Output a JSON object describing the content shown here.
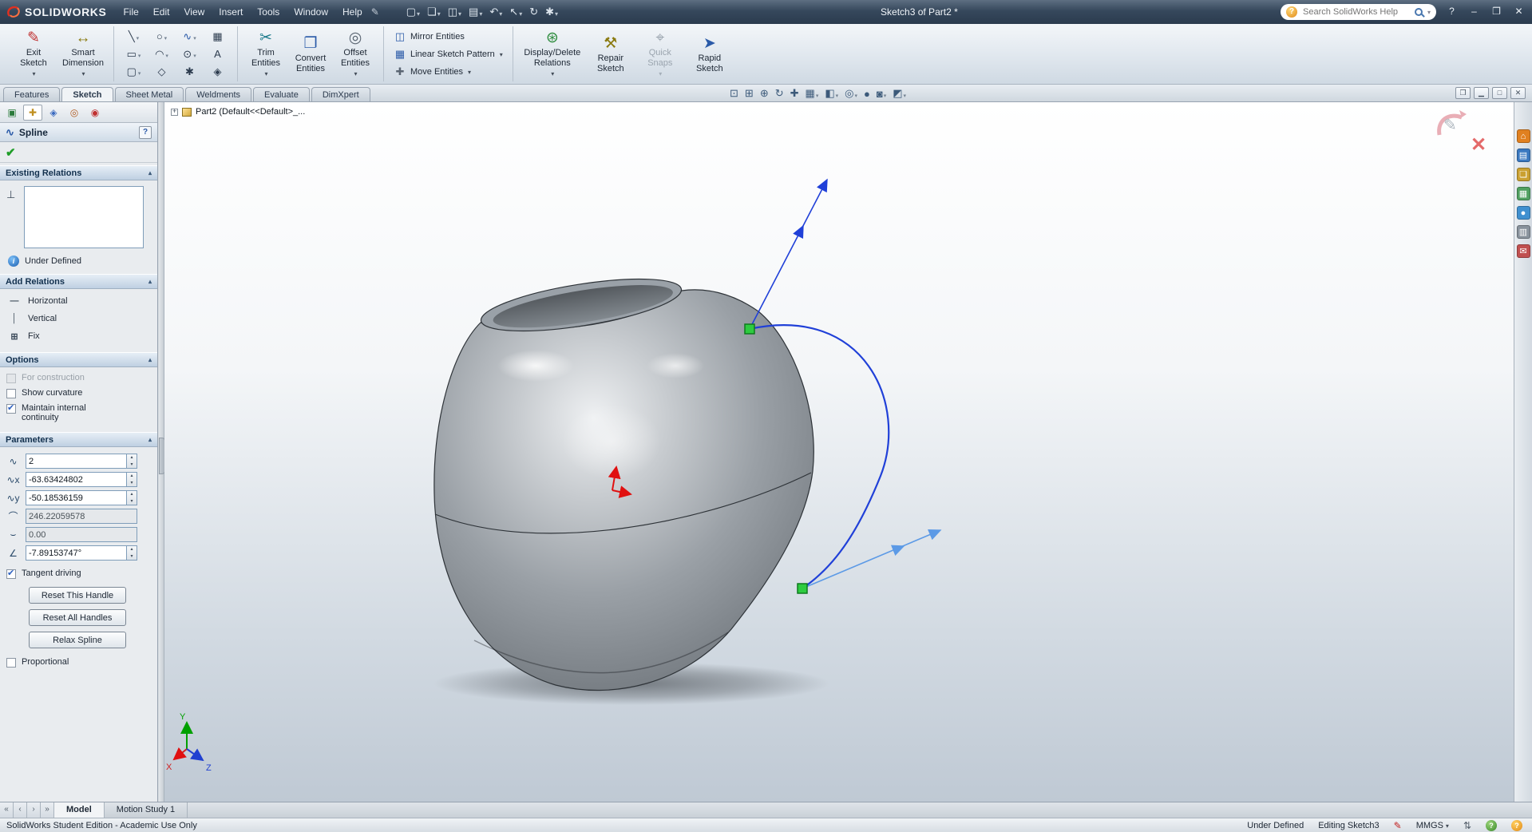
{
  "colors": {
    "spline_blue": "#2040d8",
    "tangent_blue": "#5c9ae6",
    "point_green": "#2ecc40",
    "origin_red": "#e01010",
    "header_accent": "#bfd0e2"
  },
  "icons": {
    "pin": "✎",
    "question": "?",
    "minimize": "–",
    "restore": "❐",
    "close": "✕",
    "check": "✔",
    "info": "i",
    "perpendicular": "⊥",
    "spline": "∿",
    "pencil": "✎",
    "sketch-status": "✎",
    "selection-arrows": "⇅",
    "nav-first": "«",
    "nav-prev": "‹",
    "nav-next": "›",
    "nav-last": "»"
  },
  "titlebar": {
    "logo_text": "SOLIDWORKS",
    "menus": [
      "File",
      "Edit",
      "View",
      "Insert",
      "Tools",
      "Window",
      "Help"
    ],
    "title": "Sketch3 of Part2 *",
    "search_placeholder": "Search SolidWorks Help",
    "quick_tools": [
      {
        "name": "new-document",
        "glyph": "▢"
      },
      {
        "name": "open-document",
        "glyph": "❏"
      },
      {
        "name": "save-document",
        "glyph": "◫"
      },
      {
        "name": "print-document",
        "glyph": "▤"
      },
      {
        "name": "undo",
        "glyph": "↶"
      },
      {
        "name": "select",
        "glyph": "↖"
      },
      {
        "name": "rebuild",
        "glyph": "↻"
      },
      {
        "name": "options",
        "glyph": "✱"
      }
    ]
  },
  "ribbon": {
    "exit_sketch": {
      "line1": "Exit",
      "line2": "Sketch",
      "glyph": "✎"
    },
    "smart_dimension": {
      "line1": "Smart",
      "line2": "Dimension",
      "glyph": "↔"
    },
    "sketch_tools": [
      {
        "name": "line-tool",
        "glyph": "╲"
      },
      {
        "name": "circle-tool",
        "glyph": "○"
      },
      {
        "name": "spline-tool",
        "glyph": "∿"
      },
      {
        "name": "sketch-pattern-tool",
        "glyph": "▦"
      },
      {
        "name": "rectangle-tool",
        "glyph": "▭"
      },
      {
        "name": "arc-tool",
        "glyph": "◠"
      },
      {
        "name": "ellipse-tool",
        "glyph": "⊙"
      },
      {
        "name": "text-tool",
        "glyph": "A"
      },
      {
        "name": "slot-tool",
        "glyph": "▢"
      },
      {
        "name": "polygon-tool",
        "glyph": "◇"
      },
      {
        "name": "point-tool",
        "glyph": "✱"
      },
      {
        "name": "plane-tool",
        "glyph": "◈"
      }
    ],
    "mid_buttons": [
      {
        "line1": "Trim",
        "line2": "Entities",
        "glyph": "✂"
      },
      {
        "line1": "Convert",
        "line2": "Entities",
        "glyph": "❐"
      },
      {
        "line1": "Offset",
        "line2": "Entities",
        "glyph": "◎"
      }
    ],
    "list_buttons": [
      {
        "label": "Mirror Entities",
        "glyph": "◫"
      },
      {
        "label": "Linear Sketch Pattern",
        "glyph": "▦"
      },
      {
        "label": "Move Entities",
        "glyph": "✚"
      }
    ],
    "right_buttons": [
      {
        "line1": "Display/Delete",
        "line2": "Relations",
        "glyph": "⊛",
        "disabled": false
      },
      {
        "line1": "Repair",
        "line2": "Sketch",
        "glyph": "⚒",
        "disabled": false
      },
      {
        "line1": "Quick",
        "line2": "Snaps",
        "glyph": "⌖",
        "disabled": true
      },
      {
        "line1": "Rapid",
        "line2": "Sketch",
        "glyph": "➤",
        "disabled": false
      }
    ]
  },
  "tabs": {
    "items": [
      "Features",
      "Sketch",
      "Sheet Metal",
      "Weldments",
      "Evaluate",
      "DimXpert"
    ],
    "active": "Sketch"
  },
  "view_toolbar": [
    {
      "name": "zoom-to-fit",
      "glyph": "⊡"
    },
    {
      "name": "zoom-to-area",
      "glyph": "⊞"
    },
    {
      "name": "zoom-in-out",
      "glyph": "⊕"
    },
    {
      "name": "rotate-view",
      "glyph": "↻"
    },
    {
      "name": "pan",
      "glyph": "✚"
    },
    {
      "name": "view-orientation",
      "glyph": "▦"
    },
    {
      "name": "display-style",
      "glyph": "◧"
    },
    {
      "name": "hide-show-items",
      "glyph": "◎"
    },
    {
      "name": "edit-appearance",
      "glyph": "●"
    },
    {
      "name": "apply-scene",
      "glyph": "◙"
    },
    {
      "name": "view-settings",
      "glyph": "◩"
    }
  ],
  "doc_window_buttons": [
    {
      "name": "restore-document",
      "glyph": "❐"
    },
    {
      "name": "minimize-document",
      "glyph": "▁"
    },
    {
      "name": "maximize-document",
      "glyph": "□"
    },
    {
      "name": "close-document",
      "glyph": "✕"
    }
  ],
  "property_manager": {
    "tabs": [
      {
        "name": "feature-manager-tab",
        "glyph": "▣"
      },
      {
        "name": "property-manager-tab",
        "glyph": "✚"
      },
      {
        "name": "configuration-manager-tab",
        "glyph": "◈"
      },
      {
        "name": "dimxpert-manager-tab",
        "glyph": "◎"
      },
      {
        "name": "display-manager-tab",
        "glyph": "◉"
      }
    ],
    "title": "Spline",
    "existing_relations": {
      "title": "Existing Relations",
      "status": "Under Defined"
    },
    "add_relations": {
      "title": "Add Relations",
      "items": [
        {
          "label": "Horizontal",
          "glyph": "—"
        },
        {
          "label": "Vertical",
          "glyph": "│"
        },
        {
          "label": "Fix",
          "glyph": "⊞"
        }
      ]
    },
    "options": {
      "title": "Options",
      "checkboxes": [
        {
          "label": "For construction",
          "checked": false,
          "disabled": true
        },
        {
          "label": "Show curvature",
          "checked": false,
          "disabled": false
        },
        {
          "label": "Maintain internal continuity",
          "checked": true,
          "disabled": false
        }
      ]
    },
    "parameters": {
      "title": "Parameters",
      "fields": [
        {
          "name": "spline-point-number",
          "glyph": "∿",
          "value": "2",
          "disabled": false
        },
        {
          "name": "x-coordinate",
          "glyph": "∿x",
          "value": "-63.63424802",
          "disabled": false
        },
        {
          "name": "y-coordinate",
          "glyph": "∿y",
          "value": "-50.18536159",
          "disabled": false
        },
        {
          "name": "radius-of-curvature",
          "glyph": "⌒",
          "value": "246.22059578",
          "disabled": true
        },
        {
          "name": "curvature",
          "glyph": "⌣",
          "value": "0.00",
          "disabled": true
        },
        {
          "name": "tangent-angle",
          "glyph": "∠",
          "value": "-7.89153747°",
          "disabled": false
        }
      ],
      "tangent_driving": {
        "label": "Tangent driving",
        "checked": true
      },
      "buttons": [
        "Reset This Handle",
        "Reset All Handles",
        "Relax Spline"
      ],
      "proportional": {
        "label": "Proportional",
        "checked": false
      }
    }
  },
  "viewport": {
    "tree_label": "Part2 (Default<<Default>_...",
    "axis_labels": {
      "x": "X",
      "y": "Y",
      "z": "Z"
    }
  },
  "task_pane": [
    {
      "name": "solidworks-resources",
      "glyph": "⌂"
    },
    {
      "name": "design-library",
      "glyph": "▤"
    },
    {
      "name": "file-explorer",
      "glyph": "❏"
    },
    {
      "name": "view-palette",
      "glyph": "▦"
    },
    {
      "name": "appearances-scenes",
      "glyph": "●"
    },
    {
      "name": "custom-properties",
      "glyph": "▥"
    },
    {
      "name": "forum",
      "glyph": "✉"
    }
  ],
  "bottom": {
    "tabs": [
      "Model",
      "Motion Study 1"
    ],
    "active": "Model"
  },
  "statusbar": {
    "left": "SolidWorks Student Edition - Academic Use Only",
    "constraint_status": "Under Defined",
    "editing_status": "Editing Sketch3",
    "units": "MMGS"
  }
}
